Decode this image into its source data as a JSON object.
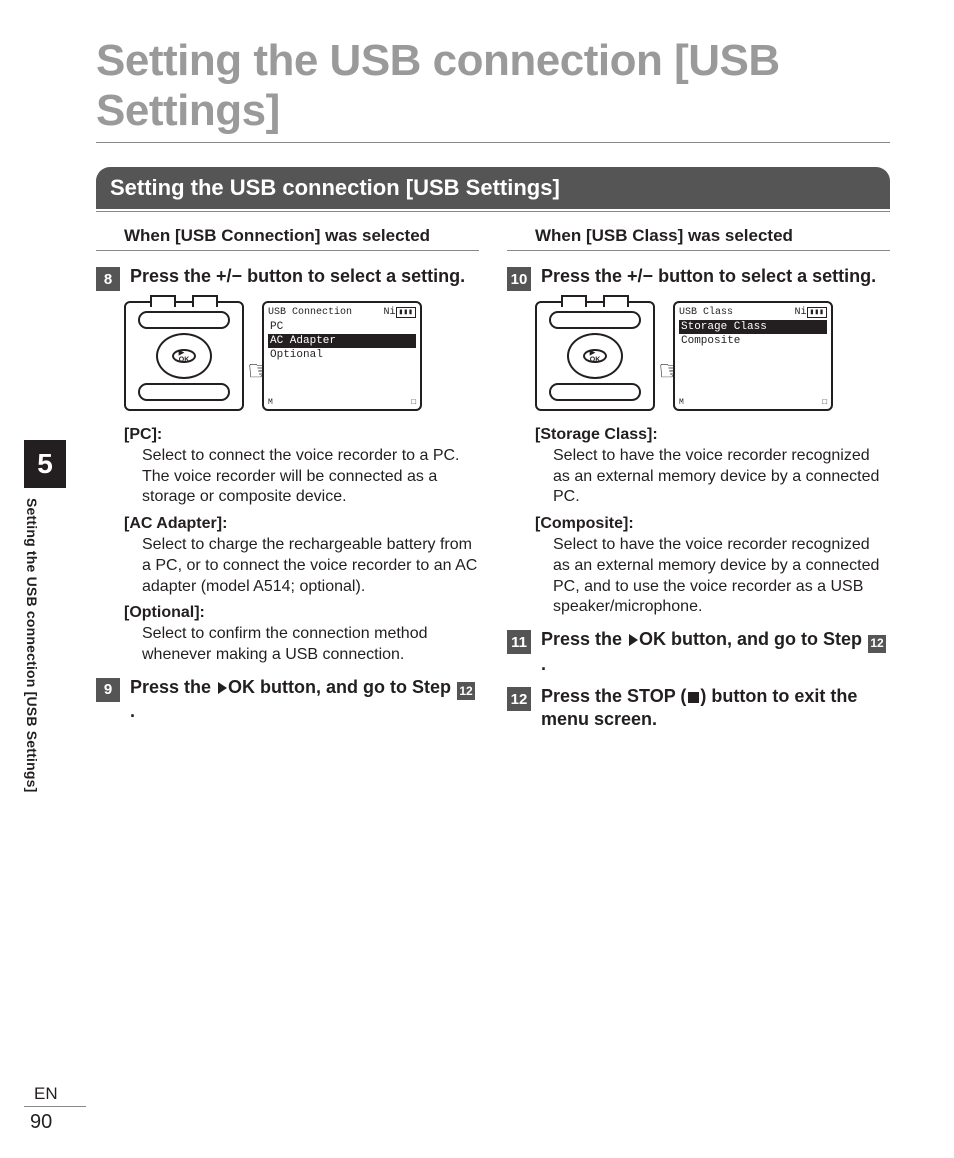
{
  "page": {
    "chapter_number": "5",
    "side_title": "Setting the USB connection [USB Settings]",
    "language_code": "EN",
    "page_number": "90",
    "main_title": "Setting the USB connection [USB Settings]",
    "section_header": "Setting the USB connection [USB Settings]"
  },
  "left": {
    "when_prefix": "When [",
    "when_strong": "USB Connection",
    "when_suffix": "] was selected",
    "step8": {
      "num": "8",
      "text_a": "Press the ",
      "text_b": "+/−",
      "text_c": " button to select a setting."
    },
    "screen": {
      "title": "USB Connection",
      "status": "Ni",
      "items": [
        "PC",
        "AC Adapter",
        "Optional"
      ],
      "selected_index": 1,
      "footer_left": "M",
      "footer_right": "□"
    },
    "defs": {
      "pc_label": "PC",
      "pc_text": "Select to connect the voice recorder to a PC. The voice recorder will be connected as a storage or composite device.",
      "ac_label": "AC Adapter",
      "ac_text": "Select to charge the rechargeable battery from a PC, or to connect the voice recorder to an AC adapter (model A514; optional).",
      "opt_label": "Optional",
      "opt_text": "Select to confirm the connection method whenever making a USB connection."
    },
    "step9": {
      "num": "9",
      "text_a": "Press the ",
      "ok": "OK",
      "text_b": " button, and go to Step ",
      "ref": "12",
      "text_c": "."
    }
  },
  "right": {
    "when_prefix": "When [",
    "when_strong": "USB Class",
    "when_suffix": "] was selected",
    "step10": {
      "num": "10",
      "text_a": "Press the ",
      "text_b": "+/−",
      "text_c": " button to select a setting."
    },
    "screen": {
      "title": "USB Class",
      "status": "Ni",
      "items": [
        "Storage Class",
        "Composite"
      ],
      "selected_index": 0,
      "footer_left": "M",
      "footer_right": "□"
    },
    "defs": {
      "sc_label": "Storage Class",
      "sc_text": "Select to have the voice recorder recognized as an external memory device by a connected PC.",
      "co_label": "Composite",
      "co_text": "Select to have the voice recorder recognized as an external memory device by a connected PC, and to use the voice recorder as a USB speaker/microphone."
    },
    "step11": {
      "num": "11",
      "text_a": "Press the ",
      "ok": "OK",
      "text_b": " button, and go to Step ",
      "ref": "12",
      "text_c": "."
    },
    "step12": {
      "num": "12",
      "text_a": "Press the ",
      "stop": "STOP",
      "text_b": " (",
      "text_c": ") button to exit the menu screen."
    }
  }
}
